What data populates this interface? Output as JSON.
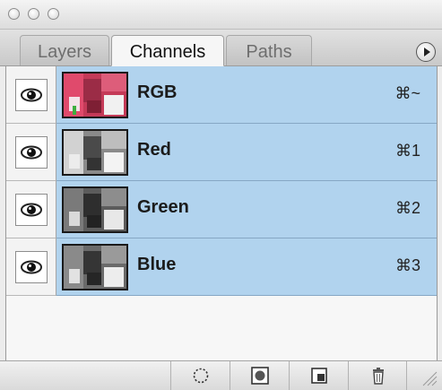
{
  "tabs": [
    {
      "label": "Layers",
      "active": false
    },
    {
      "label": "Channels",
      "active": true
    },
    {
      "label": "Paths",
      "active": false
    }
  ],
  "channels": [
    {
      "name": "RGB",
      "shortcut": "⌘~",
      "visible": true,
      "selected": true
    },
    {
      "name": "Red",
      "shortcut": "⌘1",
      "visible": true,
      "selected": true
    },
    {
      "name": "Green",
      "shortcut": "⌘2",
      "visible": true,
      "selected": true
    },
    {
      "name": "Blue",
      "shortcut": "⌘3",
      "visible": true,
      "selected": true
    }
  ],
  "toolbar": {
    "icons": [
      "load-selection-icon",
      "save-selection-icon",
      "new-channel-icon",
      "trash-icon"
    ]
  },
  "colors": {
    "selection": "#b1d3ee",
    "panel": "#ececec"
  }
}
